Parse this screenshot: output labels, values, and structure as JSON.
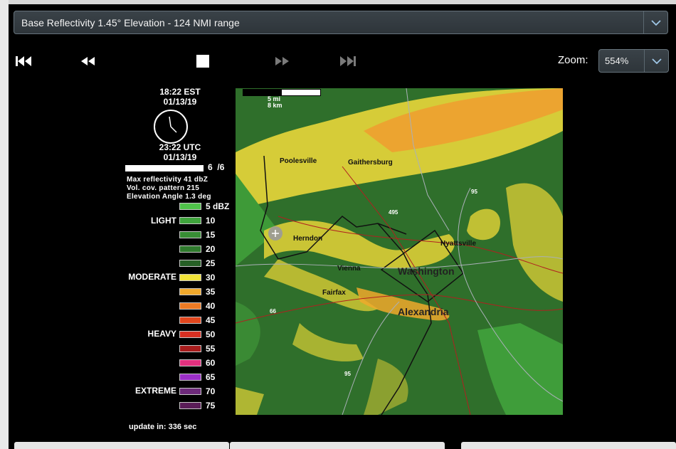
{
  "product": {
    "label": "Base Reflectivity 1.45° Elevation - 124 NMI range"
  },
  "controls": {
    "first": "skip-to-first-icon",
    "back": "step-back-icon",
    "stop": "stop-icon",
    "forward": "step-forward-icon",
    "last": "skip-to-last-icon"
  },
  "zoom": {
    "label": "Zoom:",
    "value": "554%"
  },
  "time": {
    "local": "18:22 EST",
    "local_date": "01/13/19",
    "utc": "23:22 UTC",
    "utc_date": "01/13/19"
  },
  "frames": {
    "current": "6",
    "total": "/6",
    "progress": 1.0
  },
  "meta": {
    "max_reflectivity": "Max reflectivity  41 dbZ",
    "vcp": "Vol. cov. pattern  215",
    "elevation": "Elevation Angle  1.3 deg"
  },
  "legend": {
    "categories": [
      "LIGHT",
      "MODERATE",
      "HEAVY",
      "EXTREME"
    ],
    "items": [
      {
        "label": "5  dBZ",
        "color": "#4fc24a"
      },
      {
        "label": "10",
        "color": "#3fa43c"
      },
      {
        "label": "15",
        "color": "#388e35"
      },
      {
        "label": "20",
        "color": "#2f7a2d"
      },
      {
        "label": "25",
        "color": "#265f25"
      },
      {
        "label": "30",
        "color": "#f1e33a"
      },
      {
        "label": "35",
        "color": "#f0a92c"
      },
      {
        "label": "40",
        "color": "#ec7a24"
      },
      {
        "label": "45",
        "color": "#e2461d"
      },
      {
        "label": "50",
        "color": "#d83022"
      },
      {
        "label": "55",
        "color": "#a81c1c"
      },
      {
        "label": "60",
        "color": "#e0307e"
      },
      {
        "label": "65",
        "color": "#9c2fc9"
      },
      {
        "label": "70",
        "color": "#6d2a7a"
      },
      {
        "label": "75",
        "color": "#5a1d58"
      }
    ]
  },
  "update": "update in: 336 sec",
  "map": {
    "scale_mi": "5  mi",
    "scale_km": "8  km",
    "cities": [
      "Poolesville",
      "Gaithersburg",
      "Herndon",
      "Hyattsville",
      "Vienna",
      "Washington",
      "Fairfax",
      "Alexandria"
    ],
    "routes": [
      "95",
      "495",
      "66",
      "95"
    ]
  }
}
